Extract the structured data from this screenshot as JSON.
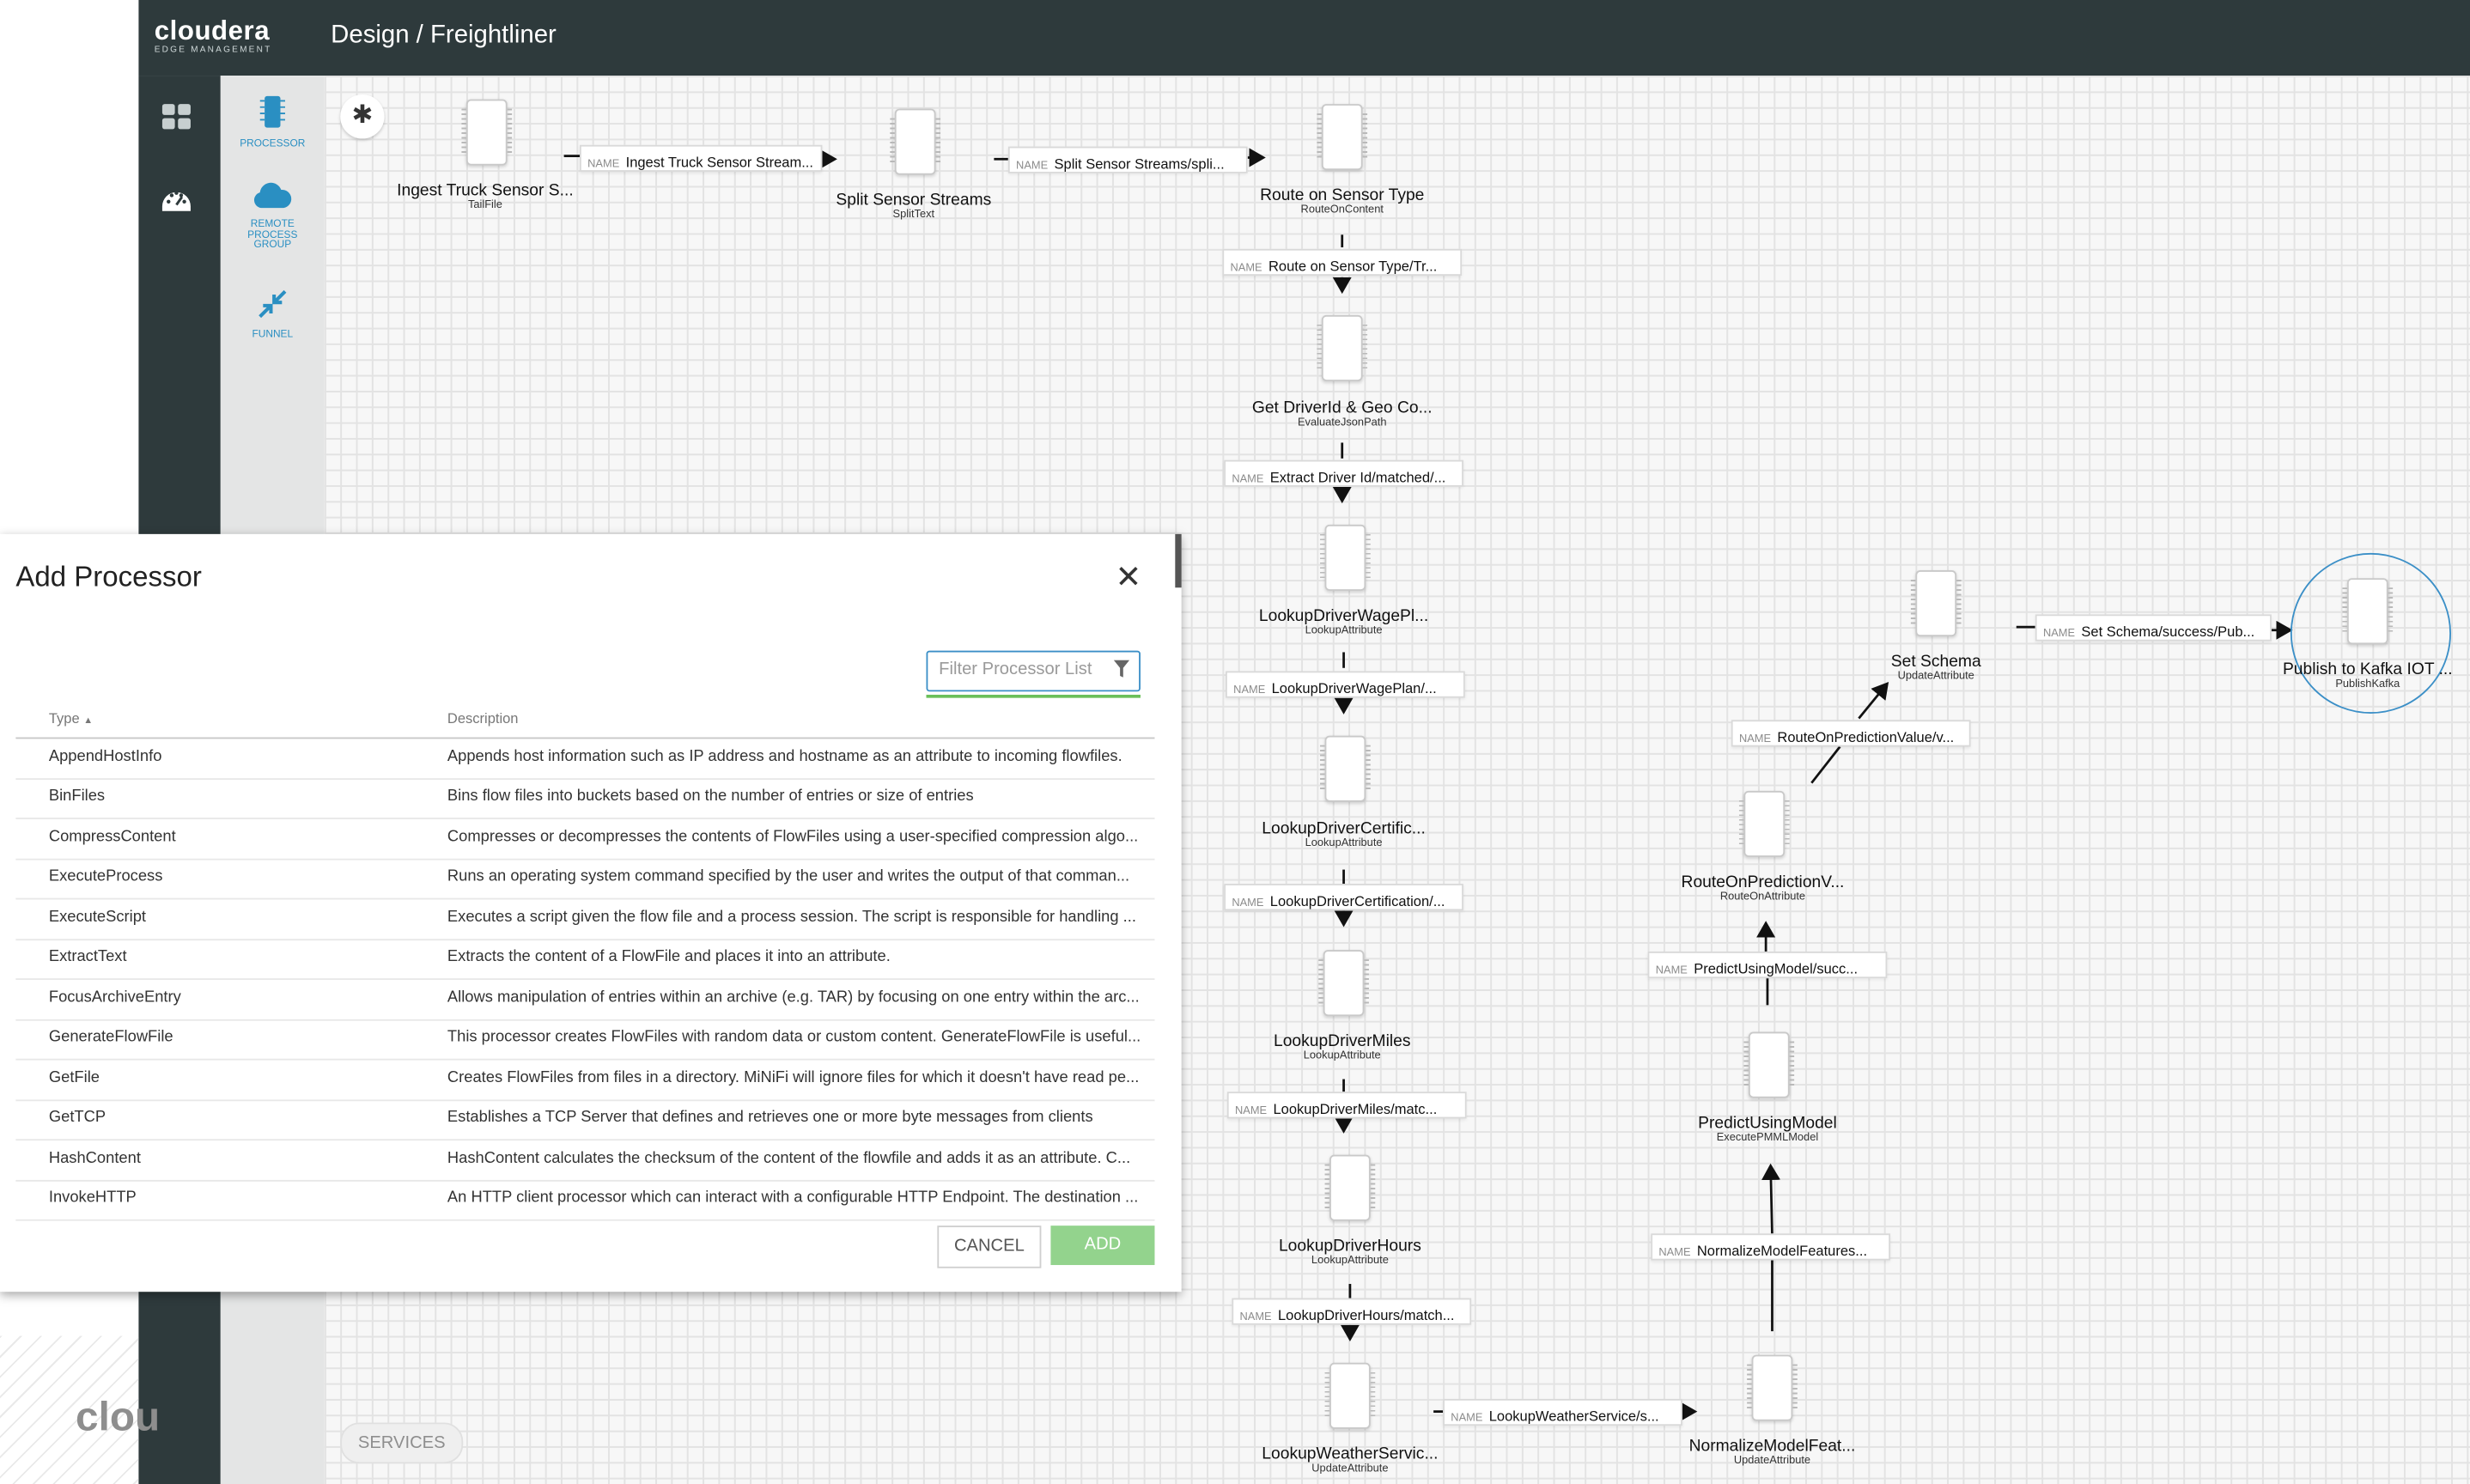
{
  "app": {
    "brand": "cloudera",
    "brand_sub": "EDGE MANAGEMENT",
    "breadcrumb": "Design / Freightliner"
  },
  "left_nav": {
    "items": [
      {
        "icon": "dashboard-grid-icon"
      },
      {
        "icon": "monitor-gauge-icon"
      }
    ]
  },
  "palette": {
    "items": [
      {
        "label": "PROCESSOR",
        "icon": "processor-chip-icon"
      },
      {
        "label": "REMOTE PROCESS GROUP",
        "icon": "cloud-icon"
      },
      {
        "label": "FUNNEL",
        "icon": "funnel-arrows-icon"
      }
    ]
  },
  "canvas": {
    "processors": [
      {
        "name": "Ingest Truck Sensor S...",
        "type": "TailFile"
      },
      {
        "name": "Split Sensor Streams",
        "type": "SplitText"
      },
      {
        "name": "Route on Sensor Type",
        "type": "RouteOnContent"
      },
      {
        "name": "Get DriverId & Geo Co...",
        "type": "EvaluateJsonPath"
      },
      {
        "name": "LookupDriverWagePl...",
        "type": "LookupAttribute"
      },
      {
        "name": "LookupDriverCertific...",
        "type": "LookupAttribute"
      },
      {
        "name": "LookupDriverMiles",
        "type": "LookupAttribute"
      },
      {
        "name": "LookupDriverHours",
        "type": "LookupAttribute"
      },
      {
        "name": "LookupWeatherServic...",
        "type": "UpdateAttribute"
      },
      {
        "name": "NormalizeModelFeat...",
        "type": "UpdateAttribute"
      },
      {
        "name": "PredictUsingModel",
        "type": "ExecutePMMLModel"
      },
      {
        "name": "RouteOnPredictionV...",
        "type": "RouteOnAttribute"
      },
      {
        "name": "Set Schema",
        "type": "UpdateAttribute"
      },
      {
        "name": "Publish to Kafka IOT ...",
        "type": "PublishKafka"
      }
    ],
    "connection_key": "NAME",
    "connections": [
      "Ingest Truck Sensor Stream...",
      "Split Sensor Streams/spli...",
      "Route on Sensor Type/Tr...",
      "Extract Driver Id/matched/...",
      "LookupDriverWagePlan/...",
      "LookupDriverCertification/...",
      "LookupDriverMiles/matc...",
      "LookupDriverHours/match...",
      "LookupWeatherService/s...",
      "NormalizeModelFeatures...",
      "PredictUsingModel/succ...",
      "RouteOnPredictionValue/v...",
      "Set Schema/success/Pub..."
    ],
    "services_label": "SERVICES",
    "bottom_brand": "clou"
  },
  "modal": {
    "title": "Add Processor",
    "filter_placeholder": "Filter Processor List",
    "filter_value": "",
    "col_type": "Type",
    "col_description": "Description",
    "rows": [
      {
        "type": "AppendHostInfo",
        "description": "Appends host information such as IP address and hostname as an attribute to incoming flowfiles."
      },
      {
        "type": "BinFiles",
        "description": "Bins flow files into buckets based on the number of entries or size of entries"
      },
      {
        "type": "CompressContent",
        "description": "Compresses or decompresses the contents of FlowFiles using a user-specified compression algo..."
      },
      {
        "type": "ExecuteProcess",
        "description": "Runs an operating system command specified by the user and writes the output of that comman..."
      },
      {
        "type": "ExecuteScript",
        "description": "Executes a script given the flow file and a process session. The script is responsible for handling ..."
      },
      {
        "type": "ExtractText",
        "description": "Extracts the content of a FlowFile and places it into an attribute."
      },
      {
        "type": "FocusArchiveEntry",
        "description": "Allows manipulation of entries within an archive (e.g. TAR) by focusing on one entry within the arc..."
      },
      {
        "type": "GenerateFlowFile",
        "description": "This processor creates FlowFiles with random data or custom content. GenerateFlowFile is useful..."
      },
      {
        "type": "GetFile",
        "description": "Creates FlowFiles from files in a directory. MiNiFi will ignore files for which it doesn't have read pe..."
      },
      {
        "type": "GetTCP",
        "description": "Establishes a TCP Server that defines and retrieves one or more byte messages from clients"
      },
      {
        "type": "HashContent",
        "description": "HashContent calculates the checksum of the content of the flowfile and adds it as an attribute. C..."
      },
      {
        "type": "InvokeHTTP",
        "description": "An HTTP client processor which can interact with a configurable HTTP Endpoint. The destination ..."
      }
    ],
    "cancel_label": "CANCEL",
    "add_label": "ADD"
  },
  "colors": {
    "header_bg": "#2e3a3c",
    "accent_blue": "#2a8fc2",
    "add_button_green": "#93d38d",
    "filter_underline_green": "#6abf59"
  }
}
